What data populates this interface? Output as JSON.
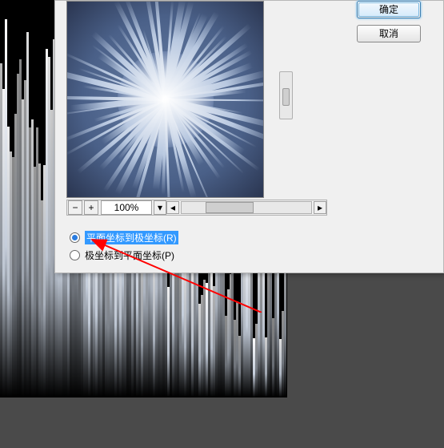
{
  "canvas": {
    "visible": true
  },
  "dialog": {
    "preview": {
      "zoom": "100%"
    },
    "zoombar": {
      "minus_label": "−",
      "plus_label": "+",
      "dropdown_glyph": "▾",
      "left_glyph": "◂",
      "right_glyph": "▸"
    },
    "radios": {
      "opt_rect_to_polar": {
        "label": "平面坐标到极坐标(R)",
        "hotkey": "R",
        "checked": true
      },
      "opt_polar_to_rect": {
        "label": "极坐标到平面坐标(P)",
        "hotkey": "P",
        "checked": false
      }
    },
    "buttons": {
      "ok": "确定",
      "cancel": "取消"
    }
  },
  "annotation": {
    "arrow_color": "#FF0000"
  }
}
